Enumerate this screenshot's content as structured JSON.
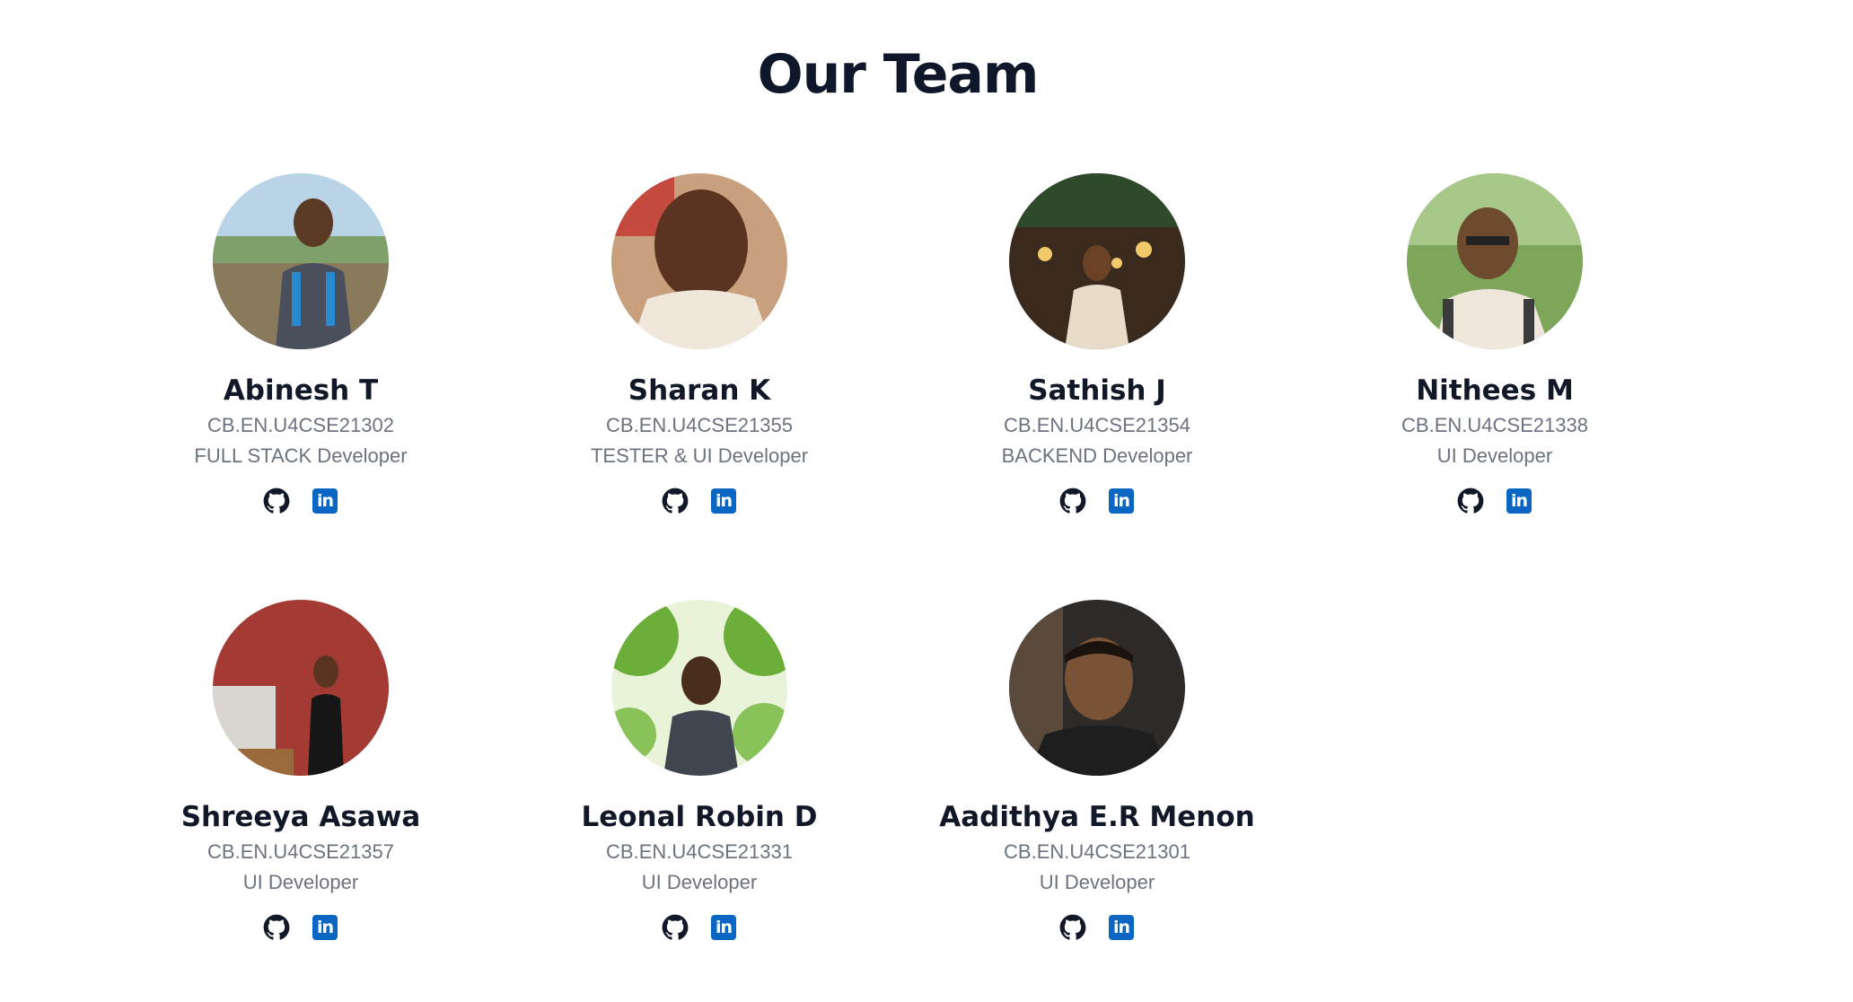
{
  "page": {
    "title": "Our Team"
  },
  "icons": {
    "github": "github-icon",
    "linkedin": "linkedin-icon"
  },
  "colors": {
    "title": "#0f172a",
    "name": "#111827",
    "muted": "#6b7280",
    "linkedin": "#0a66c2",
    "github": "#111827"
  },
  "members": [
    {
      "name": "Abinesh T",
      "roll": "CB.EN.U4CSE21302",
      "role": "FULL STACK Developer",
      "linkedin_label": "in"
    },
    {
      "name": "Sharan K",
      "roll": "CB.EN.U4CSE21355",
      "role": "TESTER & UI Developer",
      "linkedin_label": "in"
    },
    {
      "name": "Sathish J",
      "roll": "CB.EN.U4CSE21354",
      "role": "BACKEND Developer",
      "linkedin_label": "in"
    },
    {
      "name": "Nithees M",
      "roll": "CB.EN.U4CSE21338",
      "role": "UI Developer",
      "linkedin_label": "in"
    },
    {
      "name": "Shreeya Asawa",
      "roll": "CB.EN.U4CSE21357",
      "role": "UI Developer",
      "linkedin_label": "in"
    },
    {
      "name": "Leonal Robin D",
      "roll": "CB.EN.U4CSE21331",
      "role": "UI Developer",
      "linkedin_label": "in"
    },
    {
      "name": "Aadithya E.R Menon",
      "roll": "CB.EN.U4CSE21301",
      "role": "UI Developer",
      "linkedin_label": "in"
    }
  ]
}
